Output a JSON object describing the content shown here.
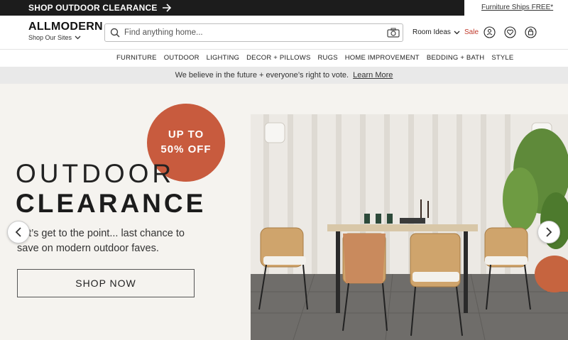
{
  "promo": {
    "text": "SHOP OUTDOOR CLEARANCE",
    "right_link": "Furniture Ships FREE*"
  },
  "header": {
    "logo": "ALLMODERN",
    "shop_sites": "Shop Our Sites",
    "search_placeholder": "Find anything home...",
    "room_ideas": "Room Ideas",
    "sale": "Sale"
  },
  "nav": {
    "items": [
      "FURNITURE",
      "OUTDOOR",
      "LIGHTING",
      "DECOR + PILLOWS",
      "RUGS",
      "HOME IMPROVEMENT",
      "BEDDING + BATH",
      "STYLE"
    ]
  },
  "notice": {
    "text": "We believe in the future + everyone’s right to vote.",
    "link": "Learn More"
  },
  "hero": {
    "badge_line1": "UP TO",
    "badge_line2": "50% OFF",
    "title_line1": "OUTDOOR",
    "title_line2": "CLEARANCE",
    "subtitle": "Let’s get to the point... last chance to save on modern outdoor faves.",
    "cta": "SHOP NOW"
  },
  "colors": {
    "promo_bg": "#1c1c1c",
    "badge": "#c85b3e",
    "sale": "#c0392b",
    "hero_bg": "#f5f3ef",
    "notice_bg": "#e9e9e9"
  },
  "icons": [
    "arrow-right-icon",
    "chevron-down-icon",
    "search-icon",
    "camera-icon",
    "account-icon",
    "heart-icon",
    "bag-icon",
    "chevron-left-icon",
    "chevron-right-icon"
  ]
}
